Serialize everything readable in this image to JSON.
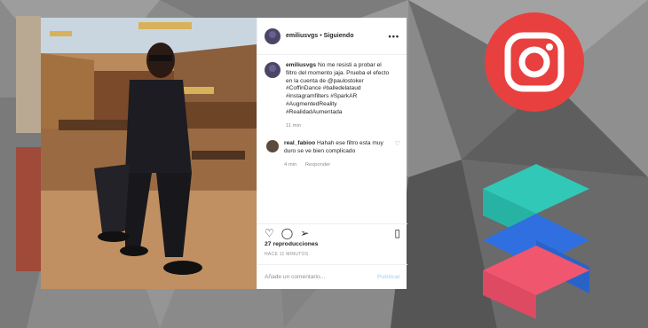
{
  "post": {
    "username": "emiliusvgs",
    "separator": "•",
    "follow_status": "Siguiendo",
    "caption_user": "emiliusvgs",
    "caption": "No me resisti a probar el filtro del momento jaja. Prueba el efecto en la cuenta de @paulostoker #CoffinDance #balledelataud #instagramfilters #SparkAR #AugmentedReality #RealidadAumentada",
    "caption_time": "11 min",
    "reply_user": "real_fabioo",
    "reply_text": "Hahah ese filtro esta muy duro se ve bien complicado",
    "reply_time": "4 min",
    "reply_action": "Responder",
    "views": "27 reproducciones",
    "posted_ago": "HACE 11 MINUTOS",
    "comment_placeholder": "Añade un comentario...",
    "publish_label": "Publicar"
  },
  "icons": [
    "more-icon",
    "heart-icon",
    "comment-icon",
    "share-icon",
    "bookmark-icon",
    "instagram-logo-icon",
    "spark-ar-logo-icon"
  ],
  "colors": {
    "instagram": "#e8403f",
    "spark_cyan": "#31c8b8",
    "spark_blue": "#2f6fe0",
    "spark_pink": "#f0566e"
  }
}
